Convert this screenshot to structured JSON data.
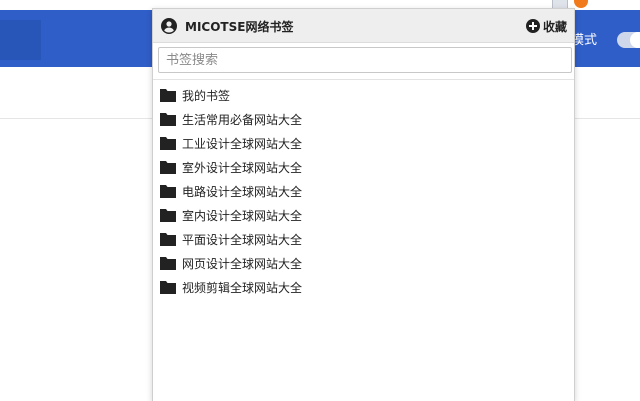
{
  "background": {
    "mode_label": "模式"
  },
  "popup": {
    "title": "MICOTSE网络书签",
    "bookmark_label": "收藏",
    "search": {
      "placeholder": "书签搜索",
      "value": ""
    },
    "folders": [
      "我的书签",
      "生活常用必备网站大全",
      "工业设计全球网站大全",
      "室外设计全球网站大全",
      "电路设计全球网站大全",
      "室内设计全球网站大全",
      "平面设计全球网站大全",
      "网页设计全球网站大全",
      "视频剪辑全球网站大全"
    ]
  },
  "icons": {
    "user": "user-circle-icon",
    "add": "plus-circle-icon",
    "folder": "folder-icon"
  },
  "colors": {
    "header_blue": "#2f5ec8",
    "popup_header": "#eeeeee",
    "folder": "#222222"
  }
}
